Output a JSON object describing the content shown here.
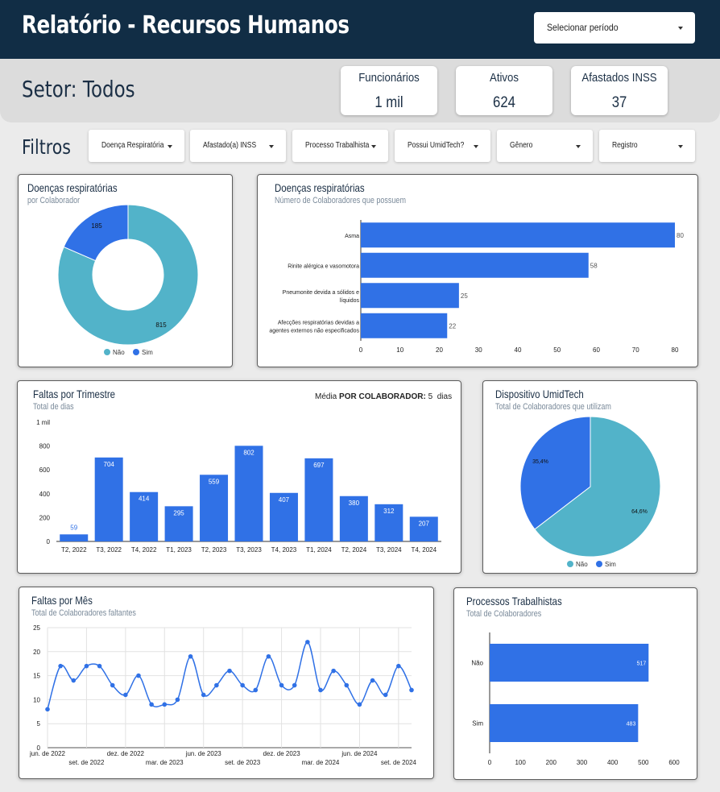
{
  "header": {
    "title": "Relatório - Recursos Humanos",
    "period_label": "Selecionar período"
  },
  "sector": {
    "label": "Setor: Todos"
  },
  "kpis": [
    {
      "label": "Funcionários",
      "value": "1 mil"
    },
    {
      "label": "Ativos",
      "value": "624"
    },
    {
      "label": "Afastados INSS",
      "value": "37"
    }
  ],
  "filters": {
    "title": "Filtros",
    "items": [
      {
        "label": "Doença Respiratória"
      },
      {
        "label": "Afastado(a) INSS"
      },
      {
        "label": "Processo Trabalhista"
      },
      {
        "label": "Possui UmidTech?"
      },
      {
        "label": "Gênero"
      },
      {
        "label": "Registro"
      }
    ]
  },
  "cards": {
    "resp_donut": {
      "title": "Doenças respiratórias",
      "subtitle": "por Colaborador"
    },
    "resp_bar": {
      "title": "Doenças respiratórias",
      "subtitle": "Número de Colaboradores que possuem"
    },
    "faltas_tri": {
      "title": "Faltas por Trimestre",
      "subtitle": "Total de dias",
      "media_prefix": "Média",
      "media_bold": "POR COLABORADOR:",
      "media_value": "5",
      "media_unit": "dias"
    },
    "umidtech": {
      "title": "Dispositivo UmidTech",
      "subtitle": "Total de Colaboradores que utilizam"
    },
    "faltas_mes": {
      "title": "Faltas por Mês",
      "subtitle": "Total de Colaboradores faltantes"
    },
    "processos": {
      "title": "Processos Trabalhistas",
      "subtitle": "Total de Colaboradores"
    }
  },
  "colors": {
    "blue": "#3071e6",
    "teal": "#52b3c9",
    "navy": "#112d45"
  },
  "chart_data": [
    {
      "id": "resp_donut",
      "type": "pie",
      "donut": true,
      "slices": [
        {
          "label": "Não",
          "value": 815,
          "color": "#52b3c9"
        },
        {
          "label": "Sim",
          "value": 185,
          "color": "#3071e6"
        }
      ],
      "legend": "bottom"
    },
    {
      "id": "resp_bar",
      "type": "bar",
      "orientation": "horizontal",
      "categories": [
        [
          "Asma"
        ],
        [
          "Rinite alérgica e vasomotora"
        ],
        [
          "Pneumonite devida a sólidos e",
          "líquidos"
        ],
        [
          "Afecções respiratórias devidas a",
          "agentes externos não especificados"
        ]
      ],
      "values": [
        80,
        58,
        25,
        22
      ],
      "xlim": [
        0,
        80
      ],
      "ticks": [
        0,
        10,
        20,
        30,
        40,
        50,
        60,
        70,
        80
      ]
    },
    {
      "id": "faltas_tri",
      "type": "bar",
      "categories": [
        "T2, 2022",
        "T3, 2022",
        "T4, 2022",
        "T1, 2023",
        "T2, 2023",
        "T3, 2023",
        "T4, 2023",
        "T1, 2024",
        "T2, 2024",
        "T3, 2024",
        "T4, 2024"
      ],
      "values": [
        59,
        704,
        414,
        295,
        559,
        802,
        407,
        697,
        380,
        312,
        207
      ],
      "ylim": [
        0,
        1000
      ],
      "yticks": [
        0,
        200,
        400,
        600,
        800,
        1000
      ],
      "ytick_labels": [
        "0",
        "200",
        "400",
        "600",
        "800",
        "1 mil"
      ]
    },
    {
      "id": "umidtech",
      "type": "pie",
      "slices": [
        {
          "label": "Não",
          "value": 64.6,
          "display": "64,6%",
          "color": "#52b3c9"
        },
        {
          "label": "Sim",
          "value": 35.4,
          "display": "35,4%",
          "color": "#3071e6"
        }
      ],
      "legend": "bottom"
    },
    {
      "id": "faltas_mes",
      "type": "line",
      "x": [
        "2022-06",
        "2022-07",
        "2022-08",
        "2022-09",
        "2022-10",
        "2022-11",
        "2022-12",
        "2023-01",
        "2023-02",
        "2023-03",
        "2023-04",
        "2023-05",
        "2023-06",
        "2023-07",
        "2023-08",
        "2023-09",
        "2023-10",
        "2023-11",
        "2023-12",
        "2024-01",
        "2024-02",
        "2024-03",
        "2024-04",
        "2024-05",
        "2024-06",
        "2024-07",
        "2024-08",
        "2024-09"
      ],
      "values": [
        8,
        17,
        14,
        17,
        17,
        13,
        11,
        15,
        9,
        9,
        10,
        19,
        11,
        13,
        16,
        13,
        12,
        19,
        13,
        13,
        22,
        12,
        16,
        13,
        9,
        14,
        11,
        17,
        12
      ],
      "ylim": [
        0,
        25
      ],
      "yticks": [
        0,
        5,
        10,
        15,
        20,
        25
      ],
      "xtick_labels_top": [
        "jun. de 2022",
        "dez. de 2022",
        "jun. de 2023",
        "dez. de 2023",
        "jun. de 2024"
      ],
      "xtick_labels_bottom": [
        "set. de 2022",
        "mar. de 2023",
        "set. de 2023",
        "mar. de 2024",
        "set. de 2024"
      ],
      "grid": true
    },
    {
      "id": "processos",
      "type": "bar",
      "orientation": "horizontal",
      "categories": [
        "Não",
        "Sim"
      ],
      "values": [
        517,
        483
      ],
      "xlim": [
        0,
        600
      ],
      "ticks": [
        0,
        100,
        200,
        300,
        400,
        500,
        600
      ]
    }
  ]
}
